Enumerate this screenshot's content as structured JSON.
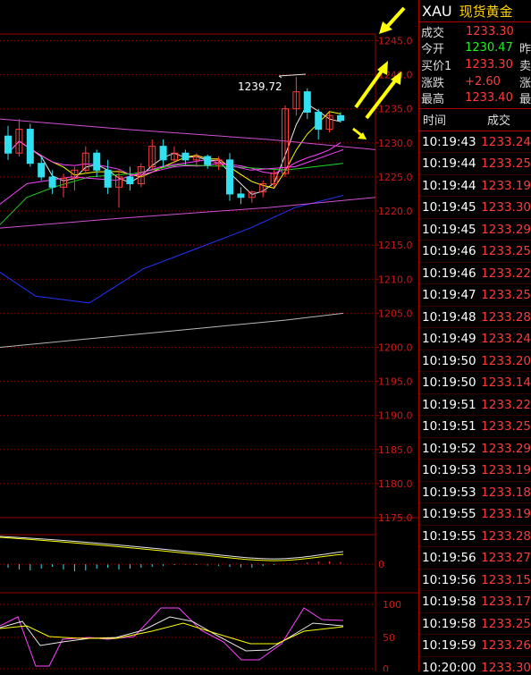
{
  "price_axis": {
    "ticks": [
      "1245.0",
      "1240.0",
      "1235.0",
      "1230.0",
      "1225.0",
      "1220.0",
      "1215.0",
      "1210.0",
      "1205.0",
      "1200.0",
      "1195.0",
      "1190.0",
      "1185.0",
      "1180.0",
      "1175.0"
    ],
    "min": 1175,
    "max": 1245
  },
  "annotation": {
    "high_label": "1239.72"
  },
  "indicator1": {
    "zero_label": "0"
  },
  "indicator2": {
    "labels": [
      "100",
      "50",
      "0"
    ]
  },
  "colors": {
    "up_candle": "#ff3b3b",
    "down_candle": "#30e0f0",
    "ma_white": "#e8e8e8",
    "ma_yellow": "#ffff00",
    "ma_magenta": "#ff40ff",
    "ma_green": "#22cc22",
    "ma_blue": "#2233ff",
    "ma_gray": "#b8b8b8",
    "trendline": "#d050d0",
    "arrow": "#ffff00",
    "grid": "#990000"
  },
  "candles": [
    {
      "o": 1231.0,
      "h": 1232.5,
      "l": 1227.5,
      "c": 1228.5
    },
    {
      "o": 1228.5,
      "h": 1233.5,
      "l": 1228.0,
      "c": 1232.0
    },
    {
      "o": 1232.0,
      "h": 1232.8,
      "l": 1226.5,
      "c": 1227.0
    },
    {
      "o": 1227.0,
      "h": 1228.0,
      "l": 1224.5,
      "c": 1225.0
    },
    {
      "o": 1225.0,
      "h": 1226.0,
      "l": 1222.5,
      "c": 1223.5
    },
    {
      "o": 1223.5,
      "h": 1225.5,
      "l": 1222.0,
      "c": 1224.8
    },
    {
      "o": 1224.8,
      "h": 1226.5,
      "l": 1223.0,
      "c": 1226.0
    },
    {
      "o": 1226.0,
      "h": 1229.5,
      "l": 1225.5,
      "c": 1228.5
    },
    {
      "o": 1228.5,
      "h": 1229.0,
      "l": 1225.0,
      "c": 1226.0
    },
    {
      "o": 1226.0,
      "h": 1227.5,
      "l": 1222.5,
      "c": 1223.5
    },
    {
      "o": 1223.5,
      "h": 1226.0,
      "l": 1220.5,
      "c": 1225.0
    },
    {
      "o": 1225.0,
      "h": 1226.5,
      "l": 1223.0,
      "c": 1224.0
    },
    {
      "o": 1224.0,
      "h": 1227.0,
      "l": 1223.5,
      "c": 1226.5
    },
    {
      "o": 1226.5,
      "h": 1230.5,
      "l": 1226.0,
      "c": 1229.5
    },
    {
      "o": 1229.5,
      "h": 1230.5,
      "l": 1226.5,
      "c": 1227.5
    },
    {
      "o": 1227.5,
      "h": 1229.5,
      "l": 1227.0,
      "c": 1228.5
    },
    {
      "o": 1228.5,
      "h": 1229.0,
      "l": 1226.8,
      "c": 1227.5
    },
    {
      "o": 1227.5,
      "h": 1228.5,
      "l": 1226.5,
      "c": 1228.0
    },
    {
      "o": 1228.0,
      "h": 1228.3,
      "l": 1226.2,
      "c": 1226.8
    },
    {
      "o": 1226.8,
      "h": 1228.0,
      "l": 1226.0,
      "c": 1227.5
    },
    {
      "o": 1227.5,
      "h": 1228.5,
      "l": 1221.5,
      "c": 1222.5
    },
    {
      "o": 1222.5,
      "h": 1223.5,
      "l": 1221.0,
      "c": 1222.0
    },
    {
      "o": 1222.0,
      "h": 1223.0,
      "l": 1221.2,
      "c": 1222.8
    },
    {
      "o": 1222.8,
      "h": 1224.5,
      "l": 1222.0,
      "c": 1224.0
    },
    {
      "o": 1224.0,
      "h": 1226.0,
      "l": 1223.5,
      "c": 1225.5
    },
    {
      "o": 1225.5,
      "h": 1235.5,
      "l": 1225.0,
      "c": 1235.0
    },
    {
      "o": 1235.0,
      "h": 1239.7,
      "l": 1234.0,
      "c": 1237.5
    },
    {
      "o": 1237.5,
      "h": 1238.0,
      "l": 1233.5,
      "c": 1234.5
    },
    {
      "o": 1234.5,
      "h": 1235.0,
      "l": 1230.5,
      "c": 1232.0
    },
    {
      "o": 1232.0,
      "h": 1234.5,
      "l": 1231.5,
      "c": 1234.0
    },
    {
      "o": 1234.0,
      "h": 1234.5,
      "l": 1233.0,
      "c": 1233.3
    }
  ],
  "quote": {
    "code": "XAU",
    "name": "现货黄金",
    "rows": [
      {
        "label": "成交",
        "value": "1233.30",
        "color": "red",
        "extra": ""
      },
      {
        "label": "今开",
        "value": "1230.47",
        "color": "green",
        "extra": "昨"
      },
      {
        "label": "买价1",
        "value": "1233.30",
        "color": "red",
        "extra": "卖"
      },
      {
        "label": "涨跌",
        "value": "+2.60",
        "color": "red",
        "extra": "涨"
      },
      {
        "label": "最高",
        "value": "1233.40",
        "color": "red",
        "extra": "最"
      }
    ]
  },
  "ticks_table": {
    "headers": [
      "时间",
      "成交"
    ],
    "rows": [
      [
        "10:19:43",
        "1233.24"
      ],
      [
        "10:19:44",
        "1233.25"
      ],
      [
        "10:19:44",
        "1233.19"
      ],
      [
        "10:19:45",
        "1233.30"
      ],
      [
        "10:19:45",
        "1233.29"
      ],
      [
        "10:19:46",
        "1233.25"
      ],
      [
        "10:19:46",
        "1233.22"
      ],
      [
        "10:19:47",
        "1233.25"
      ],
      [
        "10:19:48",
        "1233.28"
      ],
      [
        "10:19:49",
        "1233.24"
      ],
      [
        "10:19:50",
        "1233.20"
      ],
      [
        "10:19:50",
        "1233.14"
      ],
      [
        "10:19:51",
        "1233.22"
      ],
      [
        "10:19:51",
        "1233.25"
      ],
      [
        "10:19:52",
        "1233.29"
      ],
      [
        "10:19:53",
        "1233.19"
      ],
      [
        "10:19:53",
        "1233.18"
      ],
      [
        "10:19:55",
        "1233.19"
      ],
      [
        "10:19:55",
        "1233.28"
      ],
      [
        "10:19:56",
        "1233.27"
      ],
      [
        "10:19:56",
        "1233.15"
      ],
      [
        "10:19:58",
        "1233.17"
      ],
      [
        "10:19:58",
        "1233.25"
      ],
      [
        "10:19:59",
        "1233.26"
      ],
      [
        "10:20:00",
        "1233.30"
      ]
    ]
  }
}
